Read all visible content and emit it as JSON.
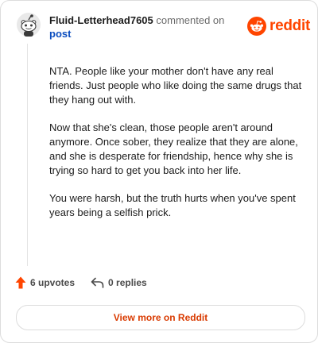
{
  "header": {
    "username": "Fluid-Letterhead7605",
    "commented_on": "commented on",
    "post_link": "post",
    "brand": "reddit"
  },
  "comment": {
    "paragraphs": [
      "NTA. People like your mother don't have any real friends. Just people who like doing the same drugs that they hang out with.",
      "Now that she's clean, those people aren't around anymore. Once sober, they realize that they are alone, and she is desperate for friendship, hence why she is trying so hard to get you back into her life.",
      "You were harsh, but the truth hurts when you've spent years being a selfish prick."
    ]
  },
  "actions": {
    "upvotes": "6 upvotes",
    "replies": "0 replies"
  },
  "view_more": "View more on Reddit",
  "colors": {
    "brand": "#ff4500",
    "upvote": "#ff4500",
    "view_more": "#d93a00",
    "link": "#0b4dbf"
  },
  "icons": {
    "avatar": "snoo-avatar-icon",
    "logo": "reddit-logo-icon",
    "upvote": "upvote-arrow-icon",
    "reply": "reply-arrow-icon"
  }
}
